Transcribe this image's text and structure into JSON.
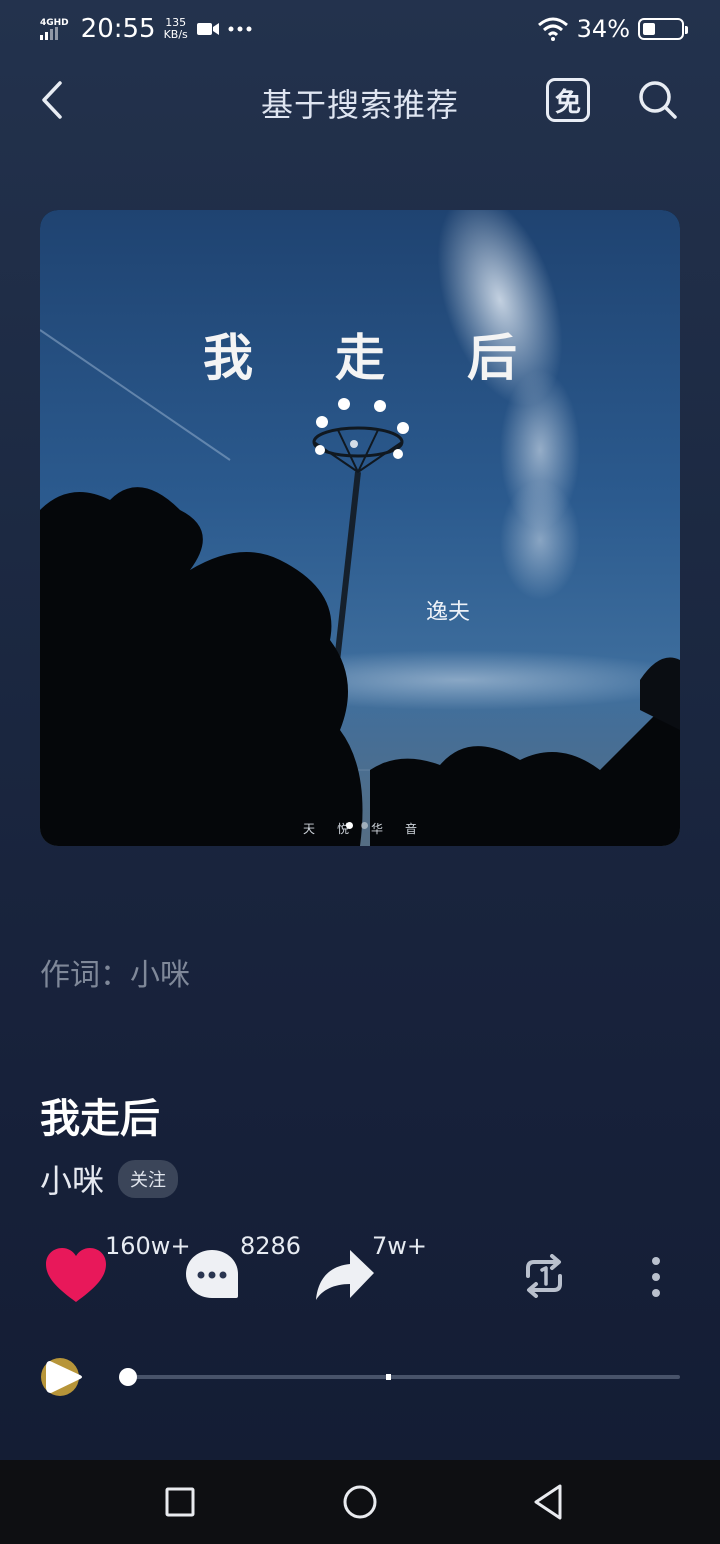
{
  "status_bar": {
    "network": "4GHD",
    "time": "20:55",
    "speed_value": "135",
    "speed_unit": "KB/s",
    "battery": "34%",
    "battery_level": 0.34,
    "icons": [
      "signal-icon",
      "video-camera-icon",
      "more-dots-icon",
      "wifi-icon",
      "battery-icon"
    ]
  },
  "header": {
    "title": "基于搜索推荐",
    "free_label": "免",
    "icons": [
      "back-arrow-icon",
      "search-icon"
    ]
  },
  "cover": {
    "title": "我走后",
    "artist_text": "逸夫",
    "label_text": "天悦华音",
    "page_count": 2,
    "active_page": 0
  },
  "lyricist": "作词：小咪",
  "song": {
    "title": "我走后",
    "artist": "小咪",
    "follow_label": "关注"
  },
  "actions": {
    "like_count": "160w+",
    "comment_count": "8286",
    "share_count": "7w+",
    "icons": [
      "heart-icon",
      "comment-icon",
      "share-icon",
      "repeat-icon",
      "more-vertical-icon"
    ]
  },
  "player": {
    "progress": 0.0
  },
  "colors": {
    "accent_like": "#e8185a",
    "background_top": "#23324d",
    "background_bottom": "#131c33"
  },
  "nav": {
    "icons": [
      "recents-square-icon",
      "home-circle-icon",
      "back-triangle-icon"
    ]
  }
}
